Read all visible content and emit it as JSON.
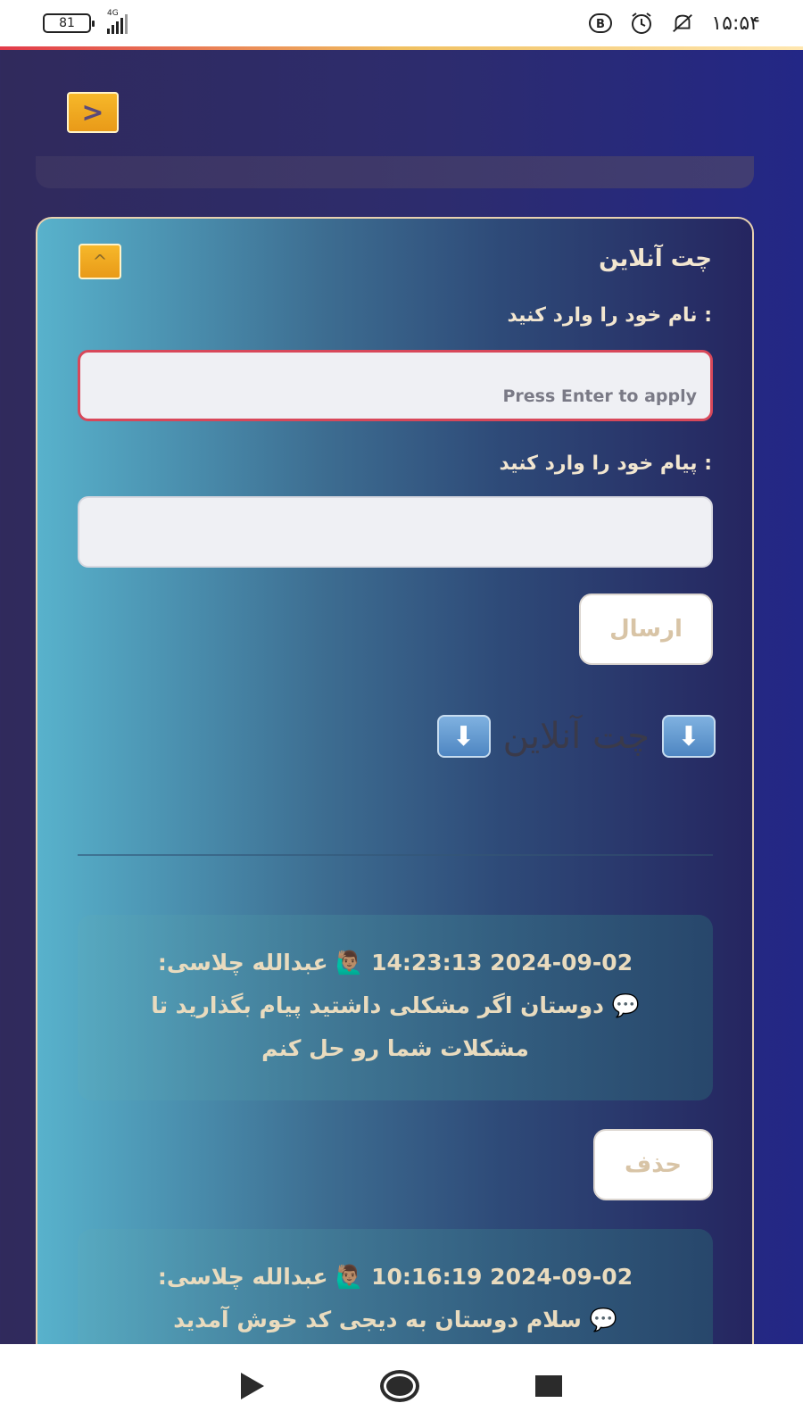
{
  "status_bar": {
    "battery": "81",
    "network": "4G",
    "time": "۱۵:۵۴",
    "icons": [
      "b-icon",
      "alarm-icon",
      "mute-icon"
    ]
  },
  "nav_toggle": {
    "icon": "chevron-right-icon",
    "glyph": ">"
  },
  "chat": {
    "title": "چت آنلاین",
    "collapse_glyph": "^",
    "name_label": ": نام خود را وارد کنید",
    "name_value": "",
    "name_hint": "Press Enter to apply",
    "message_label": ": پیام خود را وارد کنید",
    "message_value": "",
    "send_label": "ارسال",
    "section_heading": "چت آنلاین",
    "arrow_glyph": "⬇",
    "messages": [
      {
        "meta": "2024-09-02 14:23:13 🙋🏽‍♂️ عبدالله چلاسی:",
        "body": "💬 دوستان اگر مشکلی داشتید پیام بگذارید تا مشکلات شما رو حل کنم",
        "delete_label": "حذف"
      },
      {
        "meta": "2024-09-02 10:16:19 🙋🏽‍♂️ عبدالله چلاسی:",
        "body": "💬 سلام دوستان به دیجی کد خوش آمدید"
      }
    ]
  },
  "colors": {
    "accent_orange": "#f6b82a",
    "card_gradient_start": "#58b2cc",
    "card_gradient_end": "#252560",
    "text_cream": "#f2e6d0"
  }
}
